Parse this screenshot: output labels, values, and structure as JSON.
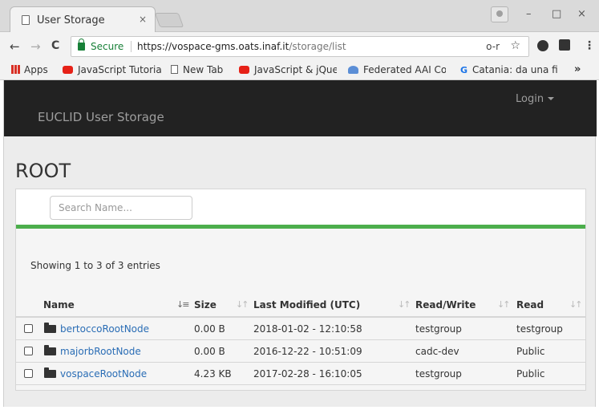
{
  "browser": {
    "tab_title": "User Storage",
    "tab_close": "×",
    "window_controls": {
      "minimize": "–",
      "maximize": "□",
      "close": "×"
    },
    "nav": {
      "back": "←",
      "forward": "→",
      "reload": "C"
    },
    "secure_label": "Secure",
    "url_host": "https://vospace-gms.oats.inaf.it",
    "url_path": "/storage/list",
    "omnibox_icons": {
      "key": "o-r",
      "star": "☆"
    },
    "menu": "⋮",
    "bookmarks": [
      {
        "label": "Apps",
        "icon": "apps-icon"
      },
      {
        "label": "JavaScript Tutoria",
        "icon": "youtube-icon"
      },
      {
        "label": "New Tab",
        "icon": "page-icon"
      },
      {
        "label": "JavaScript & jQue",
        "icon": "youtube-icon"
      },
      {
        "label": "Federated AAI Co",
        "icon": "federation-icon"
      },
      {
        "label": "Catania: da una fi",
        "icon": "google-icon"
      }
    ],
    "bookmarks_more": "»"
  },
  "navbar": {
    "brand": "EUCLID User Storage",
    "login_label": "Login"
  },
  "page": {
    "title": "ROOT"
  },
  "search": {
    "placeholder": "Search Name..."
  },
  "table": {
    "info": "Showing 1 to 3 of 3 entries",
    "columns": [
      "Name",
      "Size",
      "Last Modified (UTC)",
      "Read/Write",
      "Read"
    ],
    "rows": [
      {
        "name": "bertoccoRootNode",
        "size": "0.00 B",
        "modified": "2018-01-02 - 12:10:58",
        "read_write": "testgroup",
        "read": "testgroup"
      },
      {
        "name": "majorbRootNode",
        "size": "0.00 B",
        "modified": "2016-12-22 - 10:51:09",
        "read_write": "cadc-dev",
        "read": "Public"
      },
      {
        "name": "vospaceRootNode",
        "size": "4.23 KB",
        "modified": "2017-02-28 - 16:10:05",
        "read_write": "testgroup",
        "read": "Public"
      }
    ]
  },
  "colors": {
    "navbar_bg": "#222222",
    "accent_bar": "#4cae4c",
    "link": "#2a6db5",
    "secure": "#188038"
  }
}
